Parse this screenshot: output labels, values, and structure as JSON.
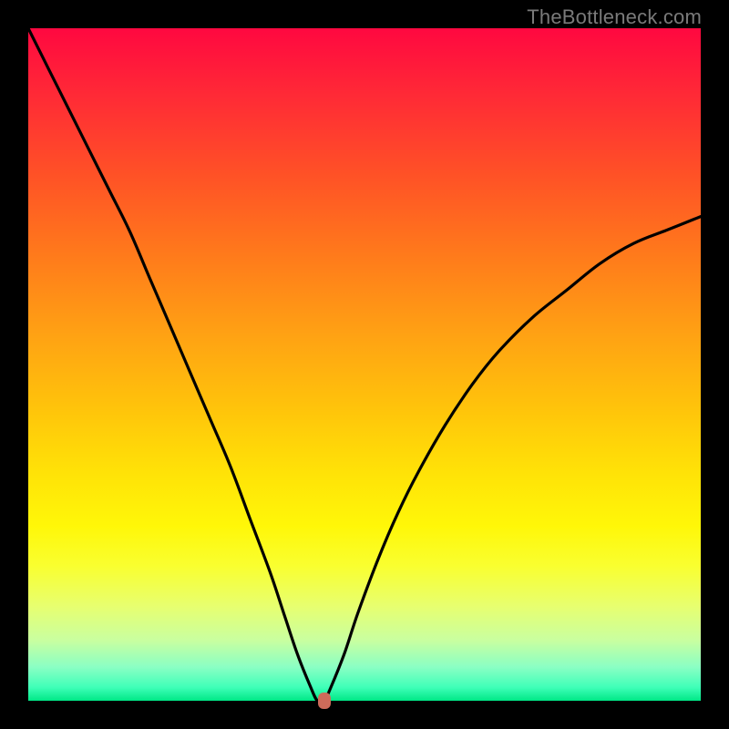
{
  "watermark": "TheBottleneck.com",
  "colors": {
    "frame": "#000000",
    "curve": "#000000",
    "marker": "#cd6b5a"
  },
  "chart_data": {
    "type": "line",
    "title": "",
    "xlabel": "",
    "ylabel": "",
    "xlim": [
      0,
      100
    ],
    "ylim": [
      0,
      100
    ],
    "grid": false,
    "legend": false,
    "x": [
      0,
      3,
      6,
      9,
      12,
      15,
      18,
      21,
      24,
      27,
      30,
      33,
      36,
      38,
      40,
      42,
      43,
      44,
      45,
      47,
      49,
      52,
      55,
      58,
      62,
      66,
      70,
      75,
      80,
      85,
      90,
      95,
      100
    ],
    "values": [
      100,
      94,
      88,
      82,
      76,
      70,
      63,
      56,
      49,
      42,
      35,
      27,
      19,
      13,
      7,
      2,
      0,
      0,
      2,
      7,
      13,
      21,
      28,
      34,
      41,
      47,
      52,
      57,
      61,
      65,
      68,
      70,
      72
    ],
    "marker": {
      "x": 44,
      "y": 0
    },
    "background_gradient": [
      {
        "pos": 0.0,
        "color": "#ff0840"
      },
      {
        "pos": 0.5,
        "color": "#ffb800"
      },
      {
        "pos": 0.8,
        "color": "#fff708"
      },
      {
        "pos": 1.0,
        "color": "#00e886"
      }
    ]
  }
}
